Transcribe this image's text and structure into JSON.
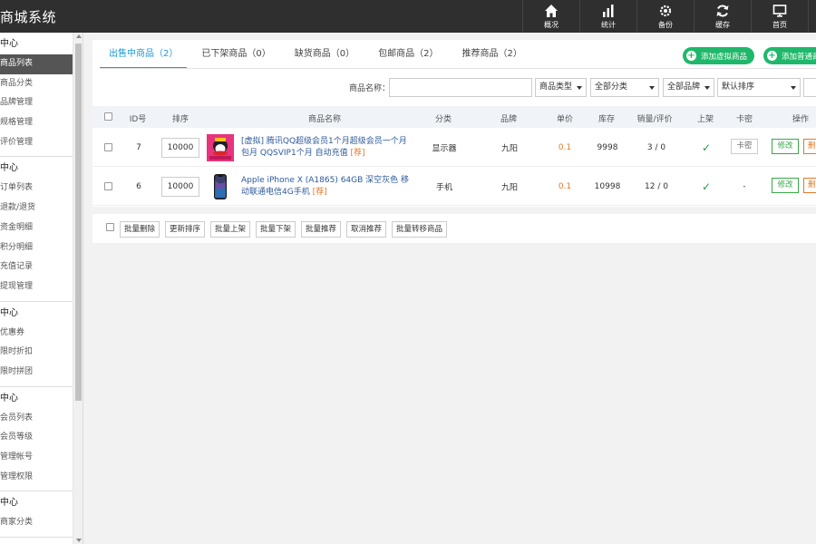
{
  "app": {
    "title": "商城系统"
  },
  "topnav": [
    {
      "label": "概况",
      "icon": "home-icon"
    },
    {
      "label": "统计",
      "icon": "bar-chart-icon"
    },
    {
      "label": "备份",
      "icon": "gear-icon"
    },
    {
      "label": "缓存",
      "icon": "refresh-icon"
    },
    {
      "label": "首页",
      "icon": "monitor-icon"
    }
  ],
  "sidebar": {
    "groups": [
      {
        "title": "中心",
        "items": [
          "商品列表",
          "商品分类",
          "品牌管理",
          "规格管理",
          "评价管理"
        ]
      },
      {
        "title": "中心",
        "items": [
          "订单列表",
          "退款/退货",
          "资金明细",
          "积分明细",
          "充值记录",
          "提现管理"
        ]
      },
      {
        "title": "中心",
        "items": [
          "优惠券",
          "限时折扣",
          "限时拼团"
        ]
      },
      {
        "title": "中心",
        "items": [
          "会员列表",
          "会员等级",
          "管理帐号",
          "管理权限"
        ]
      },
      {
        "title": "中心",
        "items": [
          "商家分类"
        ]
      }
    ]
  },
  "tabs": [
    {
      "label": "出售中商品（2）"
    },
    {
      "label": "已下架商品（0）"
    },
    {
      "label": "缺货商品（0）"
    },
    {
      "label": "包邮商品（2）"
    },
    {
      "label": "推荐商品（2）"
    }
  ],
  "actions": {
    "add_virtual": "添加虚拟商品",
    "add_normal": "添加普通商品"
  },
  "filter": {
    "name_label": "商品名称：",
    "name_value": "",
    "type_select": "商品类型",
    "category_select": "全部分类",
    "brand_select": "全部品牌",
    "sort_select": "默认排序"
  },
  "table": {
    "headers": [
      "ID号",
      "排序",
      "商品名称",
      "分类",
      "品牌",
      "单价",
      "库存",
      "销量/评价",
      "上架",
      "卡密",
      "操作"
    ],
    "rows": [
      {
        "id": "7",
        "sort": "10000",
        "name": "[虚拟] 腾讯QQ超级会员1个月超级会员一个月包月 QQSVIP1个月 自动充值",
        "tag": "[荐]",
        "category": "显示器",
        "brand": "九阳",
        "price": "0.1",
        "stock": "9998",
        "sales": "3 / 0",
        "on_sale": "✓",
        "card": "卡密",
        "edit": "修改",
        "del": "删除"
      },
      {
        "id": "6",
        "sort": "10000",
        "name": "Apple iPhone X (A1865) 64GB 深空灰色 移动联通电信4G手机",
        "tag": "[荐]",
        "category": "手机",
        "brand": "九阳",
        "price": "0.1",
        "stock": "10998",
        "sales": "12 / 0",
        "on_sale": "✓",
        "card": "-",
        "edit": "修改",
        "del": "删除"
      }
    ]
  },
  "batch": [
    "批量删除",
    "更新排序",
    "批量上架",
    "批量下架",
    "批量推荐",
    "取消推荐",
    "批量转移商品"
  ],
  "colors": {
    "accent": "#1b9bd7",
    "green": "#1fb86a",
    "topbar": "#2f2f2f",
    "price": "#e0782c"
  }
}
